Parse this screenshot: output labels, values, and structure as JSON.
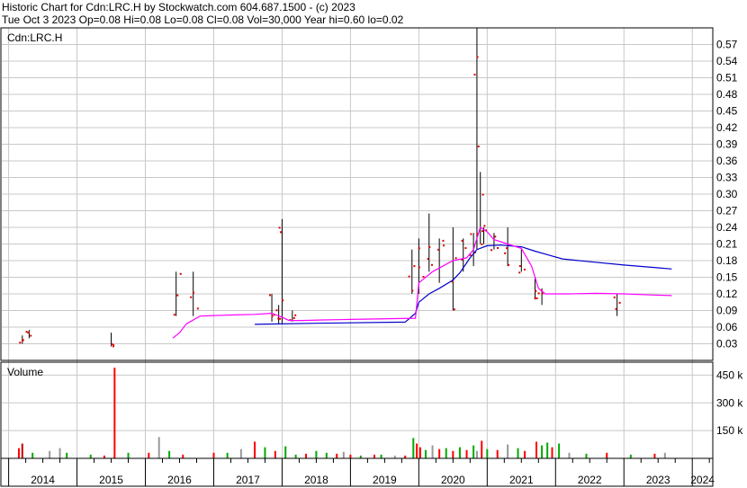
{
  "header": {
    "line1": "Historic Chart for Cdn:LRC.H by Stockwatch.com 604.687.1500 - (c) 2023",
    "line2": "Tue Oct  3 2023  Op=0.08  Hi=0.08  Lo=0.08  Cl=0.08  Vol=30,000  Year hi=0.60  lo=0.02"
  },
  "chart_data": [
    {
      "type": "line",
      "title": "Cdn:LRC.H",
      "x_axis": {
        "labels": [
          "2014",
          "2015",
          "2016",
          "2017",
          "2018",
          "2019",
          "2020",
          "2021",
          "2022",
          "2023",
          "2024"
        ],
        "range": [
          2013.9,
          2024.3
        ]
      },
      "y_axis": {
        "ticks": [
          0.03,
          0.06,
          0.09,
          0.12,
          0.15,
          0.18,
          0.21,
          0.24,
          0.27,
          0.3,
          0.33,
          0.36,
          0.39,
          0.42,
          0.45,
          0.48,
          0.51,
          0.54,
          0.57
        ],
        "range": [
          0.0,
          0.6
        ],
        "position": "right",
        "grid": true
      },
      "series": [
        {
          "color": "#0000cc",
          "points": [
            [
              2017.6,
              0.065
            ],
            [
              2018.5,
              0.067
            ],
            [
              2019.8,
              0.069
            ],
            [
              2019.95,
              0.085
            ],
            [
              2020.0,
              0.105
            ],
            [
              2020.15,
              0.12
            ],
            [
              2020.3,
              0.13
            ],
            [
              2020.5,
              0.145
            ],
            [
              2020.6,
              0.158
            ],
            [
              2020.75,
              0.185
            ],
            [
              2020.85,
              0.2
            ],
            [
              2021.0,
              0.207
            ],
            [
              2021.2,
              0.208
            ],
            [
              2021.5,
              0.205
            ],
            [
              2021.7,
              0.197
            ],
            [
              2021.9,
              0.19
            ],
            [
              2022.1,
              0.183
            ],
            [
              2022.5,
              0.178
            ],
            [
              2023.0,
              0.172
            ],
            [
              2023.5,
              0.167
            ],
            [
              2023.7,
              0.165
            ]
          ]
        },
        {
          "color": "#ff00ff",
          "points": [
            [
              2016.4,
              0.04
            ],
            [
              2016.5,
              0.05
            ],
            [
              2016.6,
              0.066
            ],
            [
              2016.8,
              0.08
            ],
            [
              2017.0,
              0.081
            ],
            [
              2017.3,
              0.082
            ],
            [
              2017.6,
              0.083
            ],
            [
              2017.85,
              0.085
            ],
            [
              2018.0,
              0.078
            ],
            [
              2018.1,
              0.072
            ],
            [
              2018.3,
              0.072
            ],
            [
              2018.6,
              0.073
            ],
            [
              2019.0,
              0.074
            ],
            [
              2019.95,
              0.076
            ],
            [
              2020.0,
              0.14
            ],
            [
              2020.2,
              0.16
            ],
            [
              2020.5,
              0.18
            ],
            [
              2020.7,
              0.185
            ],
            [
              2020.8,
              0.2
            ],
            [
              2020.9,
              0.24
            ],
            [
              2021.0,
              0.232
            ],
            [
              2021.1,
              0.218
            ],
            [
              2021.3,
              0.21
            ],
            [
              2021.5,
              0.202
            ],
            [
              2021.65,
              0.17
            ],
            [
              2021.75,
              0.13
            ],
            [
              2021.85,
              0.12
            ],
            [
              2022.2,
              0.12
            ],
            [
              2022.6,
              0.121
            ],
            [
              2023.0,
              0.12
            ],
            [
              2023.4,
              0.118
            ],
            [
              2023.7,
              0.117
            ]
          ]
        }
      ],
      "high_low_bars": [
        [
          2014.2,
          0.03,
          0.045
        ],
        [
          2014.3,
          0.04,
          0.055
        ],
        [
          2015.5,
          0.025,
          0.05
        ],
        [
          2016.45,
          0.08,
          0.16
        ],
        [
          2016.7,
          0.08,
          0.16
        ],
        [
          2017.85,
          0.07,
          0.12
        ],
        [
          2017.95,
          0.065,
          0.1
        ],
        [
          2018.0,
          0.065,
          0.255
        ],
        [
          2018.15,
          0.07,
          0.09
        ],
        [
          2019.9,
          0.12,
          0.2
        ],
        [
          2020.0,
          0.12,
          0.22
        ],
        [
          2020.15,
          0.16,
          0.265
        ],
        [
          2020.3,
          0.14,
          0.22
        ],
        [
          2020.5,
          0.09,
          0.24
        ],
        [
          2020.65,
          0.16,
          0.22
        ],
        [
          2020.8,
          0.17,
          0.23
        ],
        [
          2020.85,
          0.2,
          0.6
        ],
        [
          2020.9,
          0.21,
          0.34
        ],
        [
          2020.95,
          0.21,
          0.24
        ],
        [
          2021.1,
          0.2,
          0.23
        ],
        [
          2021.3,
          0.17,
          0.24
        ],
        [
          2021.5,
          0.16,
          0.2
        ],
        [
          2021.7,
          0.11,
          0.15
        ],
        [
          2021.8,
          0.1,
          0.13
        ],
        [
          2022.9,
          0.08,
          0.12
        ]
      ]
    },
    {
      "type": "bar",
      "title": "Volume",
      "y_axis": {
        "ticks": [
          150,
          300,
          450
        ],
        "tick_labels": [
          "150 k",
          "300 k",
          "450 k"
        ],
        "range": [
          0,
          520
        ],
        "unit": "k"
      },
      "bars": [
        [
          2014.15,
          55,
          "#ff0000"
        ],
        [
          2014.2,
          80,
          "#cc0000"
        ],
        [
          2014.35,
          30,
          "#00aa00"
        ],
        [
          2014.6,
          40,
          "#999999"
        ],
        [
          2014.75,
          55,
          "#999999"
        ],
        [
          2014.85,
          30,
          "#00aa00"
        ],
        [
          2015.2,
          20,
          "#00aa00"
        ],
        [
          2015.4,
          15,
          "#ff0000"
        ],
        [
          2015.55,
          490,
          "#ff0000"
        ],
        [
          2015.75,
          30,
          "#00aa00"
        ],
        [
          2016.05,
          30,
          "#ff0000"
        ],
        [
          2016.2,
          115,
          "#999999"
        ],
        [
          2016.35,
          40,
          "#00aa00"
        ],
        [
          2016.55,
          20,
          "#ff0000"
        ],
        [
          2017.0,
          30,
          "#ff0000"
        ],
        [
          2017.2,
          30,
          "#00aa00"
        ],
        [
          2017.4,
          50,
          "#999999"
        ],
        [
          2017.6,
          90,
          "#ff0000"
        ],
        [
          2017.75,
          60,
          "#00aa00"
        ],
        [
          2017.9,
          40,
          "#ff0000"
        ],
        [
          2018.05,
          65,
          "#00aa00"
        ],
        [
          2018.2,
          20,
          "#00aa00"
        ],
        [
          2018.35,
          25,
          "#ff0000"
        ],
        [
          2018.5,
          40,
          "#00aa00"
        ],
        [
          2018.65,
          30,
          "#00aa00"
        ],
        [
          2018.8,
          25,
          "#ff0000"
        ],
        [
          2018.9,
          35,
          "#999999"
        ],
        [
          2019.0,
          20,
          "#ff0000"
        ],
        [
          2019.15,
          15,
          "#00aa00"
        ],
        [
          2019.35,
          20,
          "#ff0000"
        ],
        [
          2019.45,
          20,
          "#00aa00"
        ],
        [
          2019.65,
          15,
          "#999999"
        ],
        [
          2019.8,
          15,
          "#ff0000"
        ],
        [
          2019.92,
          110,
          "#00aa00"
        ],
        [
          2019.97,
          80,
          "#ff0000"
        ],
        [
          2020.02,
          60,
          "#ff0000"
        ],
        [
          2020.1,
          45,
          "#00aa00"
        ],
        [
          2020.2,
          70,
          "#999999"
        ],
        [
          2020.3,
          50,
          "#ff0000"
        ],
        [
          2020.4,
          55,
          "#00aa00"
        ],
        [
          2020.5,
          40,
          "#ff0000"
        ],
        [
          2020.6,
          60,
          "#00aa00"
        ],
        [
          2020.7,
          45,
          "#ff0000"
        ],
        [
          2020.8,
          70,
          "#00aa00"
        ],
        [
          2020.85,
          40,
          "#999999"
        ],
        [
          2020.92,
          95,
          "#ff0000"
        ],
        [
          2021.0,
          50,
          "#00aa00"
        ],
        [
          2021.15,
          45,
          "#ff0000"
        ],
        [
          2021.3,
          75,
          "#999999"
        ],
        [
          2021.45,
          55,
          "#00aa00"
        ],
        [
          2021.55,
          40,
          "#ff0000"
        ],
        [
          2021.72,
          90,
          "#ff0000"
        ],
        [
          2021.8,
          70,
          "#00aa00"
        ],
        [
          2021.88,
          85,
          "#00aa00"
        ],
        [
          2021.95,
          60,
          "#ff0000"
        ],
        [
          2022.05,
          80,
          "#00aa00"
        ],
        [
          2022.2,
          30,
          "#999999"
        ],
        [
          2022.45,
          25,
          "#00aa00"
        ],
        [
          2022.75,
          30,
          "#ff0000"
        ],
        [
          2023.1,
          20,
          "#00aa00"
        ],
        [
          2023.45,
          25,
          "#ff0000"
        ],
        [
          2023.6,
          30,
          "#999999"
        ]
      ]
    }
  ],
  "colors": {
    "grid": "#c8c8c8",
    "tick_dot": "#dd0000",
    "bar": "#000000",
    "frame": "#000000"
  }
}
